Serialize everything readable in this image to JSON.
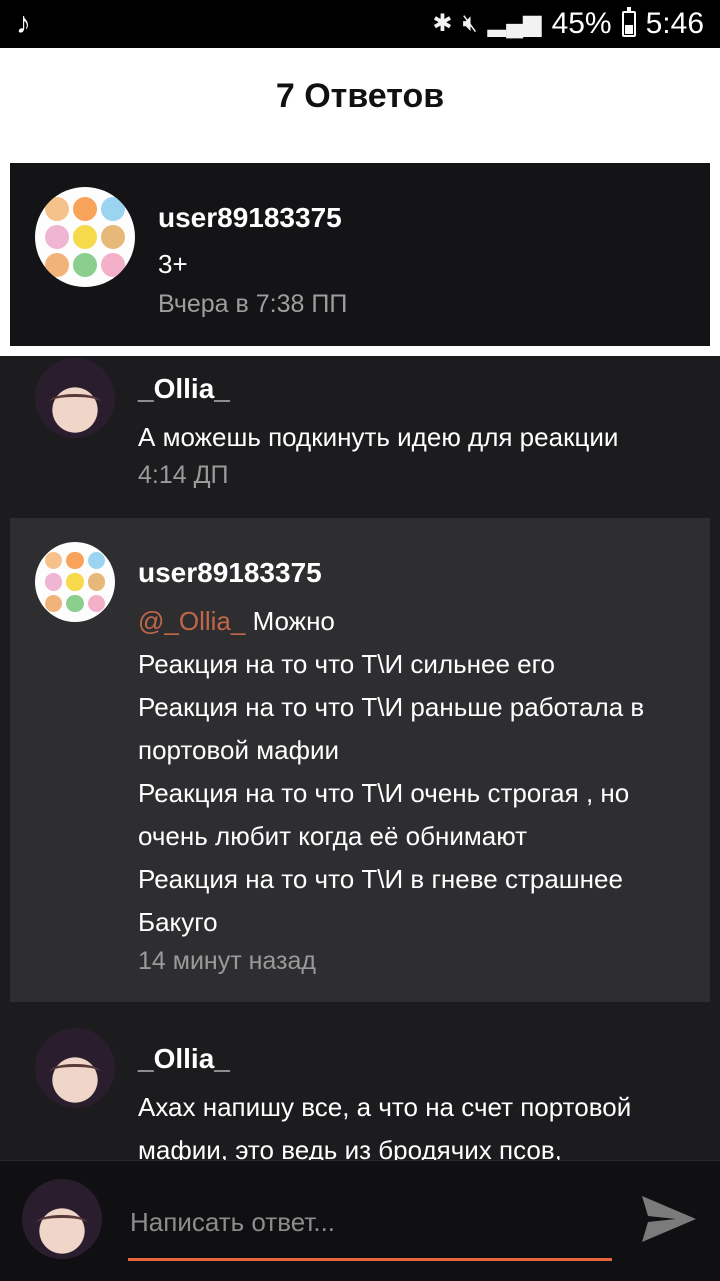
{
  "status_bar": {
    "music_icon": "music-note-icon",
    "battery_percent": "45%",
    "battery_level": 0.45,
    "time": "5:46"
  },
  "header": {
    "title": "7 Ответов"
  },
  "original_post": {
    "author": "user89183375",
    "text": "3+",
    "time": "Вчера в 7:38 ПП"
  },
  "replies": [
    {
      "author": "_Ollia_",
      "lines": [
        "А можешь подкинуть идею для реакции"
      ],
      "time": "4:14 ДП"
    },
    {
      "author": "user89183375",
      "mention": "@_Ollia_",
      "first_line": "Можно",
      "lines": [
        "Реакция на то что Т\\И сильнее его",
        "Реакция на то что Т\\И раньше работала в",
        "портовой мафии",
        "Реакция на то что Т\\И очень строгая , но",
        "очень любит когда её обнимают",
        "Реакция на то что Т\\И в гневе страшнее",
        "Бакуго"
      ],
      "time": "14 минут назад"
    },
    {
      "author": "_Ollia_",
      "lines": [
        "Ахах напишу все, а что на счет портовой",
        "мафии, это ведь из бродячих псов,"
      ]
    }
  ],
  "composer": {
    "placeholder": "Написать ответ...",
    "accent": "#e8663f"
  }
}
